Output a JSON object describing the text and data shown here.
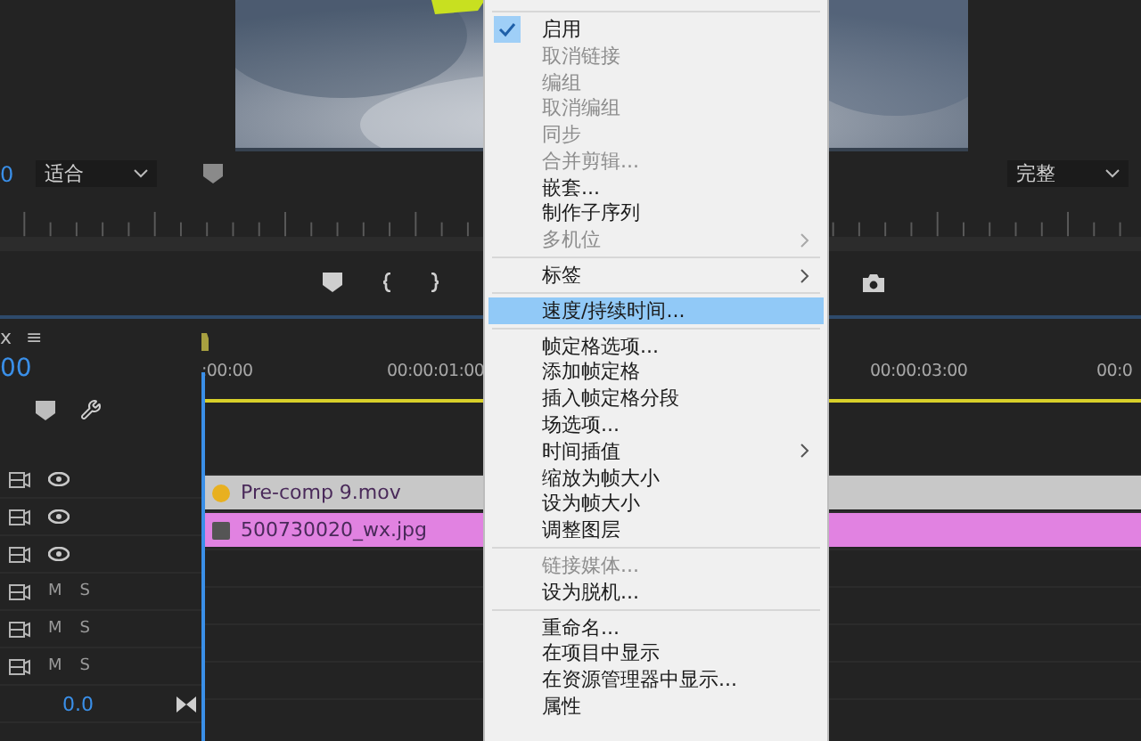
{
  "monitor": {
    "timecode": "0",
    "zoom": "适合",
    "quality": "完整"
  },
  "timeline": {
    "tab": "x",
    "menu_glyph": "≡",
    "timecode": "00",
    "ruler": [
      ":00:00",
      "00:00:01:00",
      "00:00:03:00",
      "00:0"
    ],
    "tracks": [
      {
        "kind": "video",
        "eye_on": true
      },
      {
        "kind": "video",
        "eye_on": true,
        "clip": {
          "name": "Pre-comp 9.mov",
          "color": "#c8c8c8",
          "fx_on": true
        }
      },
      {
        "kind": "video",
        "eye_on": true,
        "clip": {
          "name": "500730020_wx.jpg",
          "color": "#e182e1",
          "fx_on": false
        }
      },
      {
        "kind": "audio",
        "mute": "M",
        "solo": "S"
      },
      {
        "kind": "audio",
        "mute": "M",
        "solo": "S"
      },
      {
        "kind": "audio",
        "mute": "M",
        "solo": "S"
      },
      {
        "kind": "master",
        "volume": "0.0"
      }
    ]
  },
  "context_menu": [
    {
      "kind": "separator"
    },
    {
      "kind": "item",
      "label": "启用",
      "checked": true,
      "disabled": false,
      "selected": false,
      "submenu": false
    },
    {
      "kind": "item",
      "label": "取消链接",
      "checked": false,
      "disabled": true,
      "selected": false,
      "submenu": false
    },
    {
      "kind": "item",
      "label": "编组",
      "checked": false,
      "disabled": true,
      "selected": false,
      "submenu": false
    },
    {
      "kind": "item",
      "label": "取消编组",
      "checked": false,
      "disabled": true,
      "selected": false,
      "submenu": false
    },
    {
      "kind": "item",
      "label": "同步",
      "checked": false,
      "disabled": true,
      "selected": false,
      "submenu": false
    },
    {
      "kind": "item",
      "label": "合并剪辑...",
      "checked": false,
      "disabled": true,
      "selected": false,
      "submenu": false
    },
    {
      "kind": "item",
      "label": "嵌套...",
      "checked": false,
      "disabled": false,
      "selected": false,
      "submenu": false
    },
    {
      "kind": "item",
      "label": "制作子序列",
      "checked": false,
      "disabled": false,
      "selected": false,
      "submenu": false
    },
    {
      "kind": "item",
      "label": "多机位",
      "checked": false,
      "disabled": true,
      "selected": false,
      "submenu": true
    },
    {
      "kind": "separator"
    },
    {
      "kind": "item",
      "label": "标签",
      "checked": false,
      "disabled": false,
      "selected": false,
      "submenu": true
    },
    {
      "kind": "separator"
    },
    {
      "kind": "item",
      "label": "速度/持续时间...",
      "checked": false,
      "disabled": false,
      "selected": true,
      "submenu": false
    },
    {
      "kind": "separator"
    },
    {
      "kind": "item",
      "label": "帧定格选项...",
      "checked": false,
      "disabled": false,
      "selected": false,
      "submenu": false
    },
    {
      "kind": "item",
      "label": "添加帧定格",
      "checked": false,
      "disabled": false,
      "selected": false,
      "submenu": false
    },
    {
      "kind": "item",
      "label": "插入帧定格分段",
      "checked": false,
      "disabled": false,
      "selected": false,
      "submenu": false
    },
    {
      "kind": "item",
      "label": "场选项...",
      "checked": false,
      "disabled": false,
      "selected": false,
      "submenu": false
    },
    {
      "kind": "item",
      "label": "时间插值",
      "checked": false,
      "disabled": false,
      "selected": false,
      "submenu": true
    },
    {
      "kind": "item",
      "label": "缩放为帧大小",
      "checked": false,
      "disabled": false,
      "selected": false,
      "submenu": false
    },
    {
      "kind": "item",
      "label": "设为帧大小",
      "checked": false,
      "disabled": false,
      "selected": false,
      "submenu": false
    },
    {
      "kind": "item",
      "label": "调整图层",
      "checked": false,
      "disabled": false,
      "selected": false,
      "submenu": false
    },
    {
      "kind": "separator"
    },
    {
      "kind": "item",
      "label": "链接媒体...",
      "checked": false,
      "disabled": true,
      "selected": false,
      "submenu": false
    },
    {
      "kind": "item",
      "label": "设为脱机...",
      "checked": false,
      "disabled": false,
      "selected": false,
      "submenu": false
    },
    {
      "kind": "separator"
    },
    {
      "kind": "item",
      "label": "重命名...",
      "checked": false,
      "disabled": false,
      "selected": false,
      "submenu": false
    },
    {
      "kind": "item",
      "label": "在项目中显示",
      "checked": false,
      "disabled": false,
      "selected": false,
      "submenu": false
    },
    {
      "kind": "item",
      "label": "在资源管理器中显示...",
      "checked": false,
      "disabled": false,
      "selected": false,
      "submenu": false
    },
    {
      "kind": "item",
      "label": "属性",
      "checked": false,
      "disabled": false,
      "selected": false,
      "submenu": false
    }
  ]
}
